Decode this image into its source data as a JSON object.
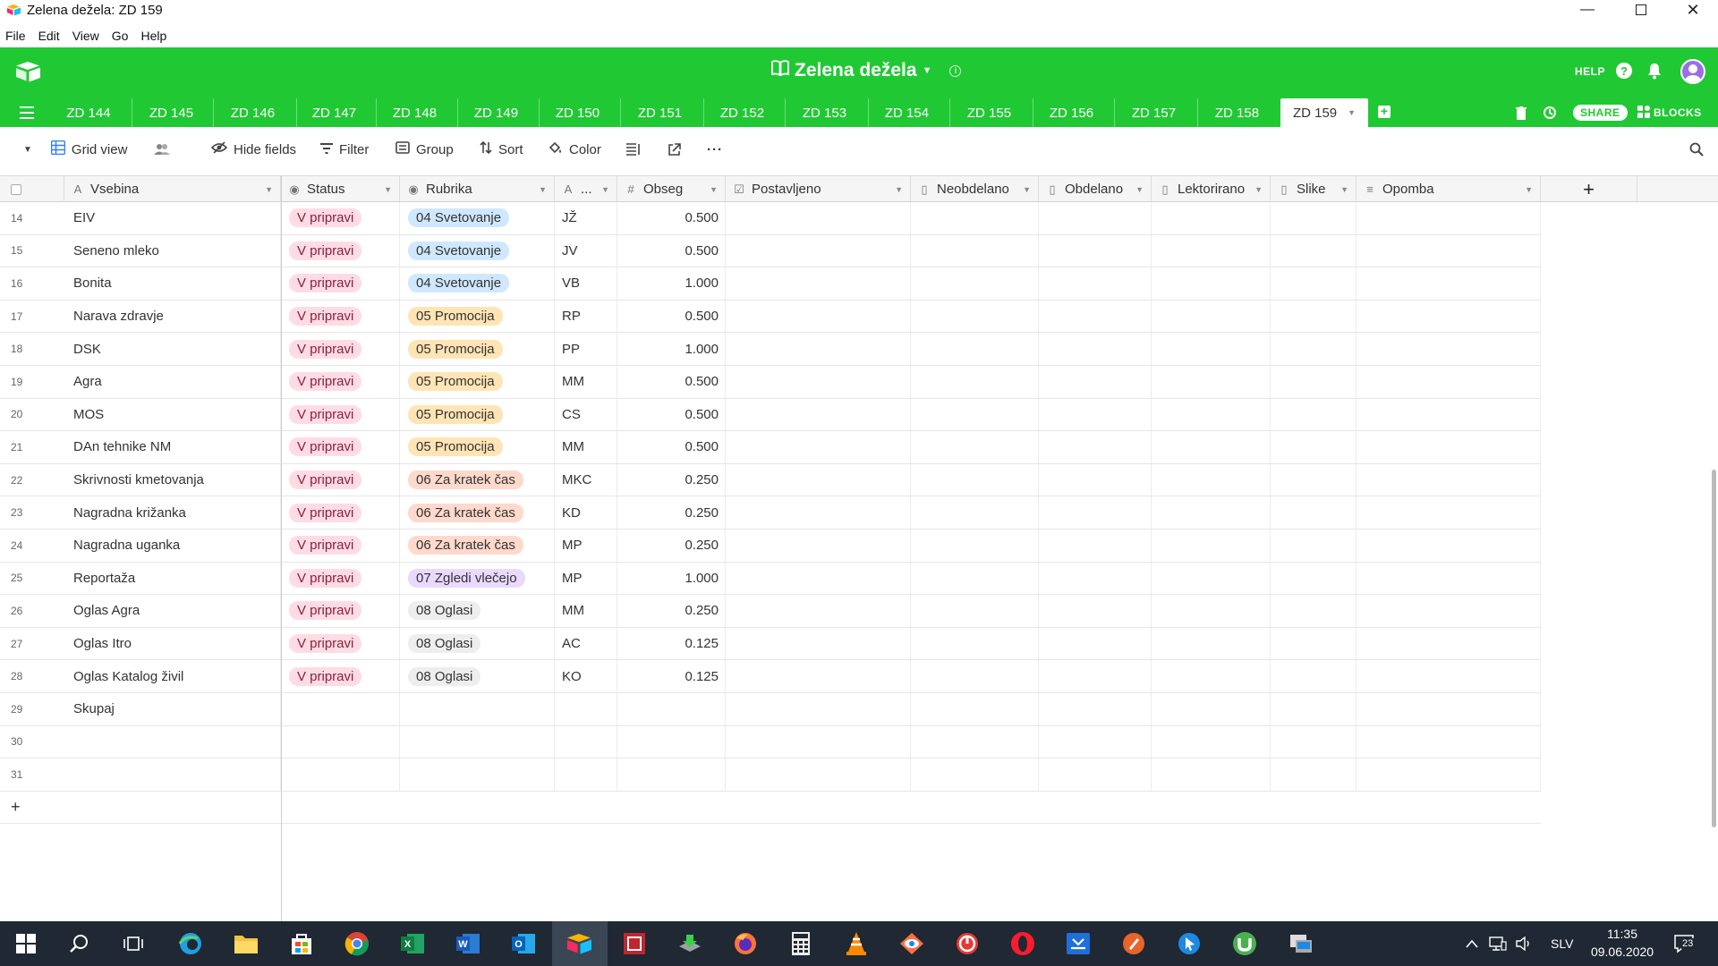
{
  "window": {
    "title": "Zelena dežela: ZD 159"
  },
  "menu": [
    "File",
    "Edit",
    "View",
    "Go",
    "Help"
  ],
  "header": {
    "base_name": "Zelena dežela",
    "help_label": "HELP"
  },
  "tabs": [
    "ZD 144",
    "ZD 145",
    "ZD 146",
    "ZD 147",
    "ZD 148",
    "ZD 149",
    "ZD 150",
    "ZD 151",
    "ZD 152",
    "ZD 153",
    "ZD 154",
    "ZD 155",
    "ZD 156",
    "ZD 157",
    "ZD 158",
    "ZD 159"
  ],
  "active_tab": "ZD 159",
  "toolbar_right": {
    "share_label": "SHARE",
    "blocks_label": "BLOCKS"
  },
  "viewbar": {
    "view_name": "Grid view",
    "hide_fields": "Hide fields",
    "filter": "Filter",
    "group": "Group",
    "sort": "Sort",
    "color": "Color"
  },
  "columns": [
    {
      "label": "Vsebina",
      "icon": "text-icon"
    },
    {
      "label": "Status",
      "icon": "single-select-icon"
    },
    {
      "label": "Rubrika",
      "icon": "single-select-icon"
    },
    {
      "label": "...",
      "icon": "text-icon"
    },
    {
      "label": "Obseg",
      "icon": "number-icon"
    },
    {
      "label": "Postavljeno",
      "icon": "checkbox-icon"
    },
    {
      "label": "Neobdelano",
      "icon": "attachment-icon"
    },
    {
      "label": "Obdelano",
      "icon": "attachment-icon"
    },
    {
      "label": "Lektorirano",
      "icon": "attachment-icon"
    },
    {
      "label": "Slike",
      "icon": "attachment-icon"
    },
    {
      "label": "Opomba",
      "icon": "long-text-icon"
    }
  ],
  "rubrika_colors": {
    "04 Svetovanje": "#cfe8ff",
    "05 Promocija": "#ffe5b5",
    "06 Za kratek čas": "#ffd9cc",
    "07 Zgledi vlečejo": "#ead9ff",
    "08 Oglasi": "#eeeeee"
  },
  "status_color": "#ffdce5",
  "rows": [
    {
      "n": "14",
      "vsebina": "EIV",
      "status": "V pripravi",
      "rubrika": "04 Svetovanje",
      "a": "JŽ",
      "obseg": "0.500"
    },
    {
      "n": "15",
      "vsebina": "Seneno mleko",
      "status": "V pripravi",
      "rubrika": "04 Svetovanje",
      "a": "JV",
      "obseg": "0.500"
    },
    {
      "n": "16",
      "vsebina": "Bonita",
      "status": "V pripravi",
      "rubrika": "04 Svetovanje",
      "a": "VB",
      "obseg": "1.000"
    },
    {
      "n": "17",
      "vsebina": "Narava zdravje",
      "status": "V pripravi",
      "rubrika": "05 Promocija",
      "a": "RP",
      "obseg": "0.500"
    },
    {
      "n": "18",
      "vsebina": "DSK",
      "status": "V pripravi",
      "rubrika": "05 Promocija",
      "a": "PP",
      "obseg": "1.000"
    },
    {
      "n": "19",
      "vsebina": "Agra",
      "status": "V pripravi",
      "rubrika": "05 Promocija",
      "a": "MM",
      "obseg": "0.500"
    },
    {
      "n": "20",
      "vsebina": "MOS",
      "status": "V pripravi",
      "rubrika": "05 Promocija",
      "a": "CS",
      "obseg": "0.500"
    },
    {
      "n": "21",
      "vsebina": "DAn tehnike NM",
      "status": "V pripravi",
      "rubrika": "05 Promocija",
      "a": "MM",
      "obseg": "0.500"
    },
    {
      "n": "22",
      "vsebina": "Skrivnosti kmetovanja",
      "status": "V pripravi",
      "rubrika": "06 Za kratek čas",
      "a": "MKC",
      "obseg": "0.250"
    },
    {
      "n": "23",
      "vsebina": "Nagradna križanka",
      "status": "V pripravi",
      "rubrika": "06 Za kratek čas",
      "a": "KD",
      "obseg": "0.250"
    },
    {
      "n": "24",
      "vsebina": "Nagradna uganka",
      "status": "V pripravi",
      "rubrika": "06 Za kratek čas",
      "a": "MP",
      "obseg": "0.250"
    },
    {
      "n": "25",
      "vsebina": "Reportaža",
      "status": "V pripravi",
      "rubrika": "07 Zgledi vlečejo",
      "a": "MP",
      "obseg": "1.000"
    },
    {
      "n": "26",
      "vsebina": "Oglas Agra",
      "status": "V pripravi",
      "rubrika": "08 Oglasi",
      "a": "MM",
      "obseg": "0.250"
    },
    {
      "n": "27",
      "vsebina": "Oglas Itro",
      "status": "V pripravi",
      "rubrika": "08 Oglasi",
      "a": "AC",
      "obseg": "0.125"
    },
    {
      "n": "28",
      "vsebina": "Oglas Katalog živil",
      "status": "V pripravi",
      "rubrika": "08 Oglasi",
      "a": "KO",
      "obseg": "0.125"
    },
    {
      "n": "29",
      "vsebina": "Skupaj",
      "status": "",
      "rubrika": "",
      "a": "",
      "obseg": ""
    },
    {
      "n": "30",
      "vsebina": "",
      "status": "",
      "rubrika": "",
      "a": "",
      "obseg": ""
    },
    {
      "n": "31",
      "vsebina": "",
      "status": "",
      "rubrika": "",
      "a": "",
      "obseg": ""
    }
  ],
  "add_row_label": "+",
  "taskbar": {
    "language": "SLV",
    "time": "11:35",
    "date": "09.06.2020",
    "notifications": "23"
  }
}
